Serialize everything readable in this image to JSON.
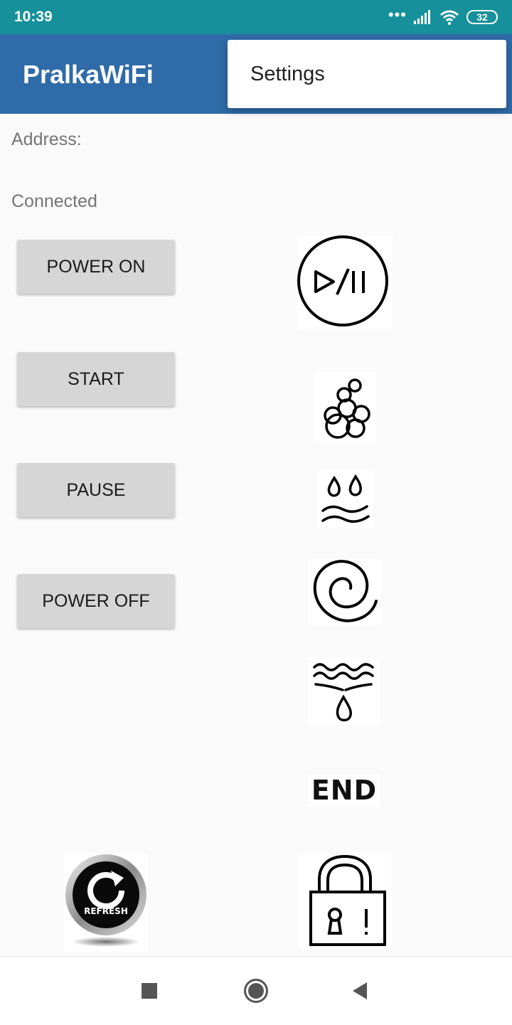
{
  "status_bar": {
    "time": "10:39",
    "battery": "32"
  },
  "app_bar": {
    "title": "PralkaWiFi"
  },
  "menu": {
    "settings_label": "Settings"
  },
  "connection": {
    "address_label": "Address:",
    "status": "Connected"
  },
  "buttons": {
    "power_on": "POWER ON",
    "start": "START",
    "pause": "PAUSE",
    "power_off": "POWER OFF",
    "refresh": "REFRESH"
  },
  "indicators": {
    "end_label": "END"
  },
  "icons": {
    "play_pause": "play-pause-icon",
    "wash": "bubbles-icon",
    "rinse": "rinse-icon",
    "spin": "spin-icon",
    "drain": "drain-icon",
    "lock": "padlock-icon"
  }
}
